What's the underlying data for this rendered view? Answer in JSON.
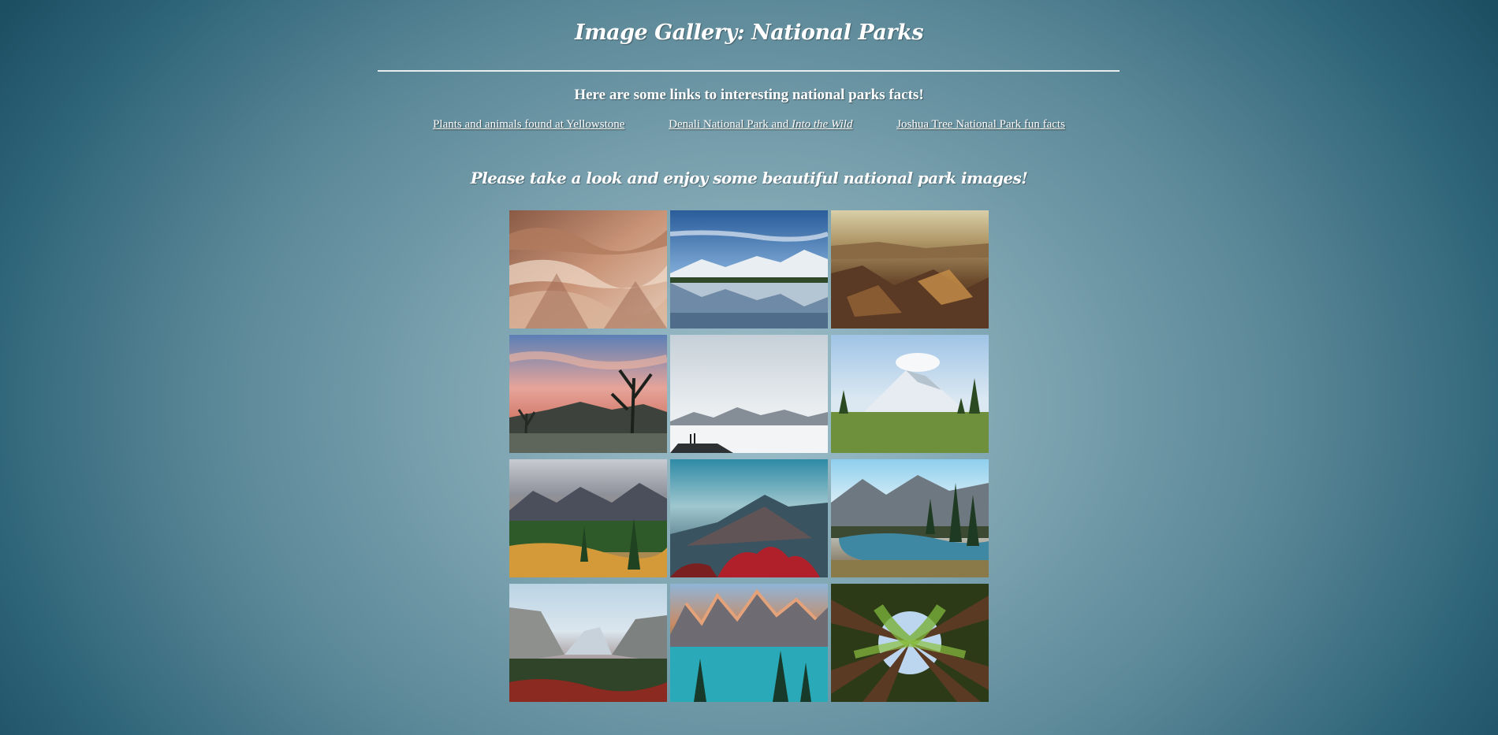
{
  "header": {
    "title": "Image Gallery: National Parks"
  },
  "intro": {
    "text": "Here are some links to interesting national parks facts!"
  },
  "links": [
    {
      "label": "Plants and animals found at Yellowstone"
    },
    {
      "label_prefix": "Denali National Park and ",
      "label_italic": "Into the Wild"
    },
    {
      "label": "Joshua Tree National Park fun facts"
    }
  ],
  "gallery": {
    "heading": "Please take a look and enjoy some beautiful national park images!",
    "images": [
      {
        "subject": "badlands-layered-hills"
      },
      {
        "subject": "mountain-lake-reflection"
      },
      {
        "subject": "grand-canyon-sunset"
      },
      {
        "subject": "joshua-trees-pink-sky"
      },
      {
        "subject": "snowfield-hikers"
      },
      {
        "subject": "mount-rainier-meadow"
      },
      {
        "subject": "autumn-mountain-valley"
      },
      {
        "subject": "teal-mountain-red-foliage"
      },
      {
        "subject": "alpine-river-pines"
      },
      {
        "subject": "yosemite-valley"
      },
      {
        "subject": "moraine-lake"
      },
      {
        "subject": "redwood-canopy"
      }
    ]
  },
  "colors": {
    "background_center": "#9ec0cb",
    "background_edge": "#1d4f63",
    "text": "#ffffff"
  }
}
